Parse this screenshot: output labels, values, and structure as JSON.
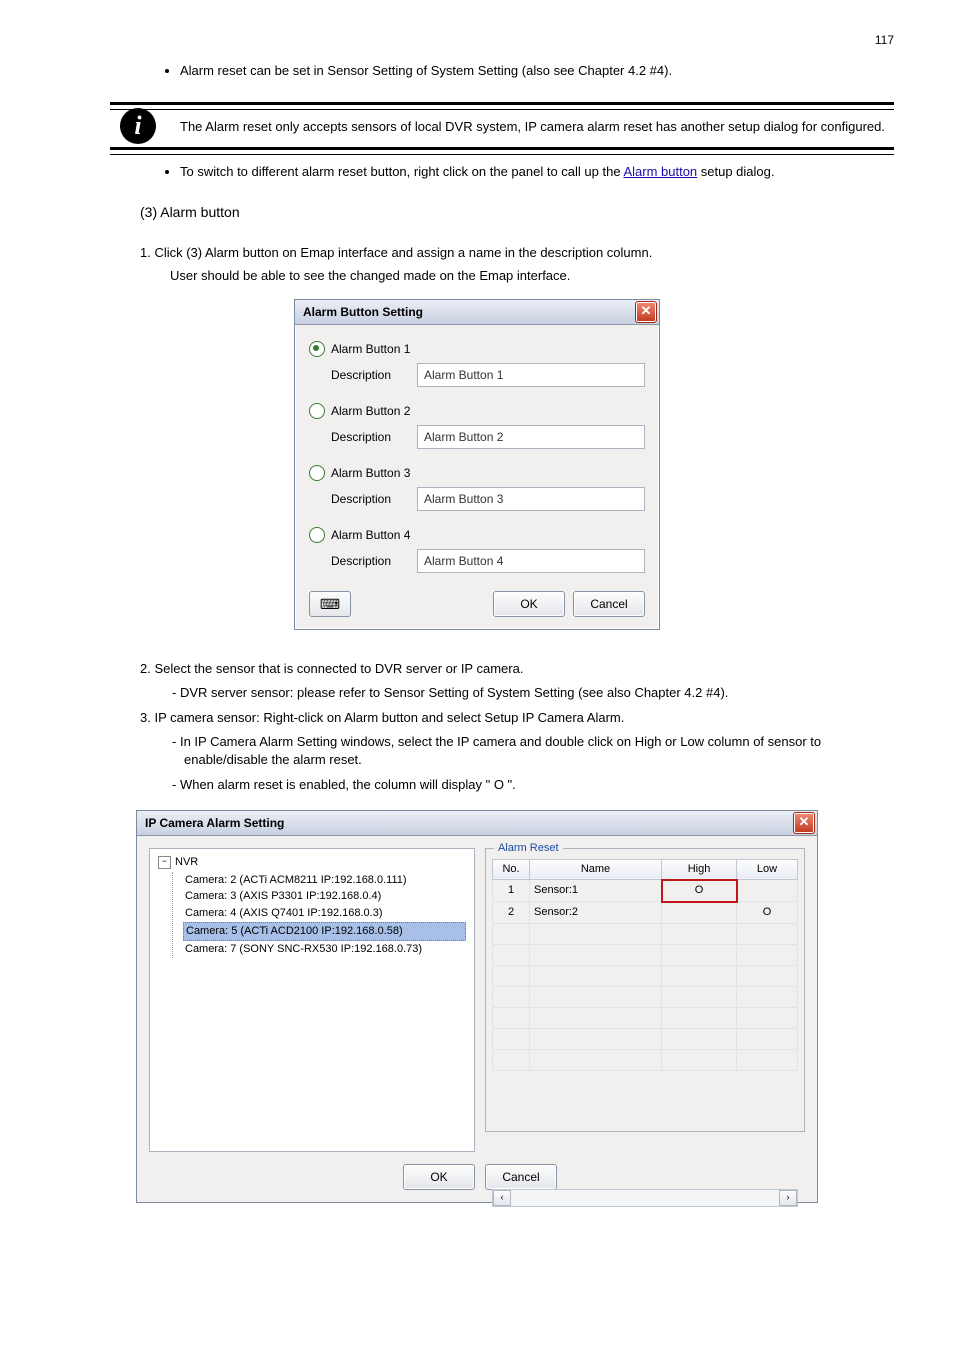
{
  "page_number": "117",
  "intro": {
    "bullet1": "Alarm reset can be set in Sensor Setting of System Setting (also see Chapter 4.2 #4).",
    "note": "The Alarm reset only accepts sensors of local DVR system, IP camera alarm reset has another setup dialog for configured.",
    "bullet2_a": "To switch to different alarm reset button, right click on the panel to call up the ",
    "bullet2_link": "Alarm button",
    "bullet2_b": " setup dialog.",
    "section": "(3) Alarm button"
  },
  "steps": {
    "s1": "1. Click (3) Alarm button on Emap interface and assign a name in the description column.",
    "s1_sub": "User should be able to see the changed made on the Emap interface.",
    "s2": "2. Select the sensor that is connected to DVR server or IP camera.",
    "s2_dash": "DVR server sensor: please refer to Sensor Setting of System Setting (see also Chapter 4.2 #4).",
    "s3": "3. IP camera sensor: Right-click on Alarm button and select Setup IP Camera Alarm.",
    "s3_dash_a": "In IP Camera Alarm Setting windows, select the IP camera and double click on High or Low column of sensor to enable/disable the alarm reset.",
    "s3_dash_b": "When alarm reset is enabled, the column will display \" O \"."
  },
  "buttons": {
    "ok": "OK",
    "cancel": "Cancel"
  },
  "dialog1": {
    "title": "Alarm Button Setting",
    "desc_label": "Description",
    "items": [
      {
        "label": "Alarm Button 1",
        "value": "Alarm Button 1",
        "selected": true
      },
      {
        "label": "Alarm Button 2",
        "value": "Alarm Button 2",
        "selected": false
      },
      {
        "label": "Alarm Button 3",
        "value": "Alarm Button 3",
        "selected": false
      },
      {
        "label": "Alarm Button 4",
        "value": "Alarm Button 4",
        "selected": false
      }
    ]
  },
  "dialog2": {
    "title": "IP Camera Alarm Setting",
    "group_label": "Alarm Reset",
    "tree": {
      "root": "NVR",
      "items": [
        "Camera: 2 (ACTi ACM8211 IP:192.168.0.111)",
        "Camera: 3 (AXIS P3301 IP:192.168.0.4)",
        "Camera: 4 (AXIS Q7401 IP:192.168.0.3)",
        "Camera: 5 (ACTi ACD2100 IP:192.168.0.58)",
        "Camera: 7 (SONY SNC-RX530 IP:192.168.0.73)"
      ],
      "selected_index": 3
    },
    "table": {
      "headers": [
        "No.",
        "Name",
        "High",
        "Low"
      ],
      "rows": [
        {
          "no": "1",
          "name": "Sensor:1",
          "high": "O",
          "low": ""
        },
        {
          "no": "2",
          "name": "Sensor:2",
          "high": "",
          "low": "O"
        }
      ]
    }
  }
}
